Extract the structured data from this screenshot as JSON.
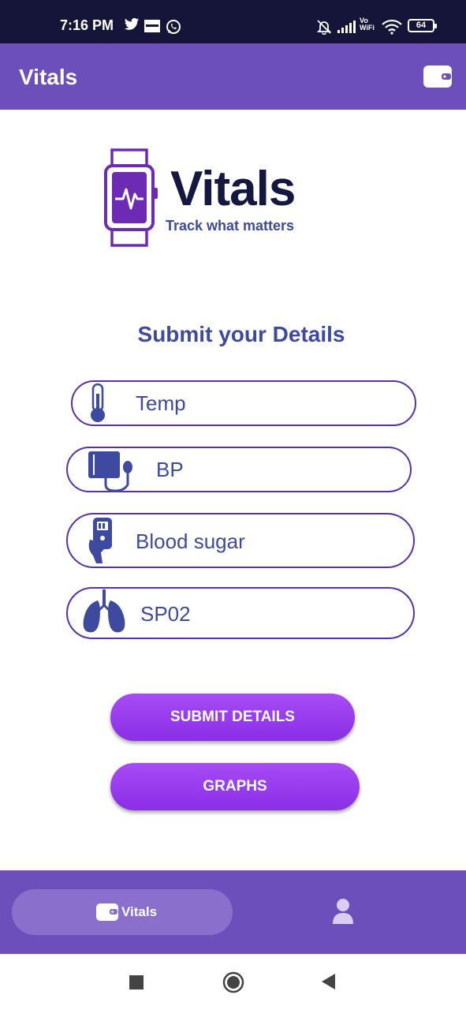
{
  "status_bar": {
    "time": "7:16 PM",
    "battery": "64",
    "icons": [
      "twitter-icon",
      "news-icon",
      "whatsapp-icon",
      "muted-bell-icon",
      "signal-icon",
      "vowifi-icon",
      "wifi-icon",
      "battery-icon"
    ],
    "vowifi": [
      "Vo",
      "WiFi"
    ]
  },
  "app_bar": {
    "title": "Vitals",
    "action_icon": "wallet-icon"
  },
  "logo": {
    "word": "Vitals",
    "tagline": "Track what matters",
    "icon": "smartwatch-heartbeat-icon"
  },
  "form": {
    "title": "Submit your Details",
    "fields": [
      {
        "placeholder": "Temp",
        "icon": "thermometer-icon"
      },
      {
        "placeholder": "BP",
        "icon": "blood-pressure-monitor-icon"
      },
      {
        "placeholder": "Blood sugar",
        "icon": "glucometer-icon"
      },
      {
        "placeholder": "SP02",
        "icon": "lungs-icon"
      }
    ]
  },
  "buttons": {
    "submit": "SUBMIT DETAILS",
    "graphs": "GRAPHS"
  },
  "bottom_nav": {
    "active_label": "Vitals",
    "active_icon": "wallet-icon",
    "other_icon": "person-icon"
  },
  "system_nav": {
    "icons": [
      "recents-square-icon",
      "home-circle-icon",
      "back-triangle-icon"
    ]
  },
  "colors": {
    "status_bar": "#15153a",
    "app_bar": "#6c4fbb",
    "accent_text": "#3d4aa0",
    "button": "#9a3ff0",
    "pill_border": "#5b2fa8"
  }
}
